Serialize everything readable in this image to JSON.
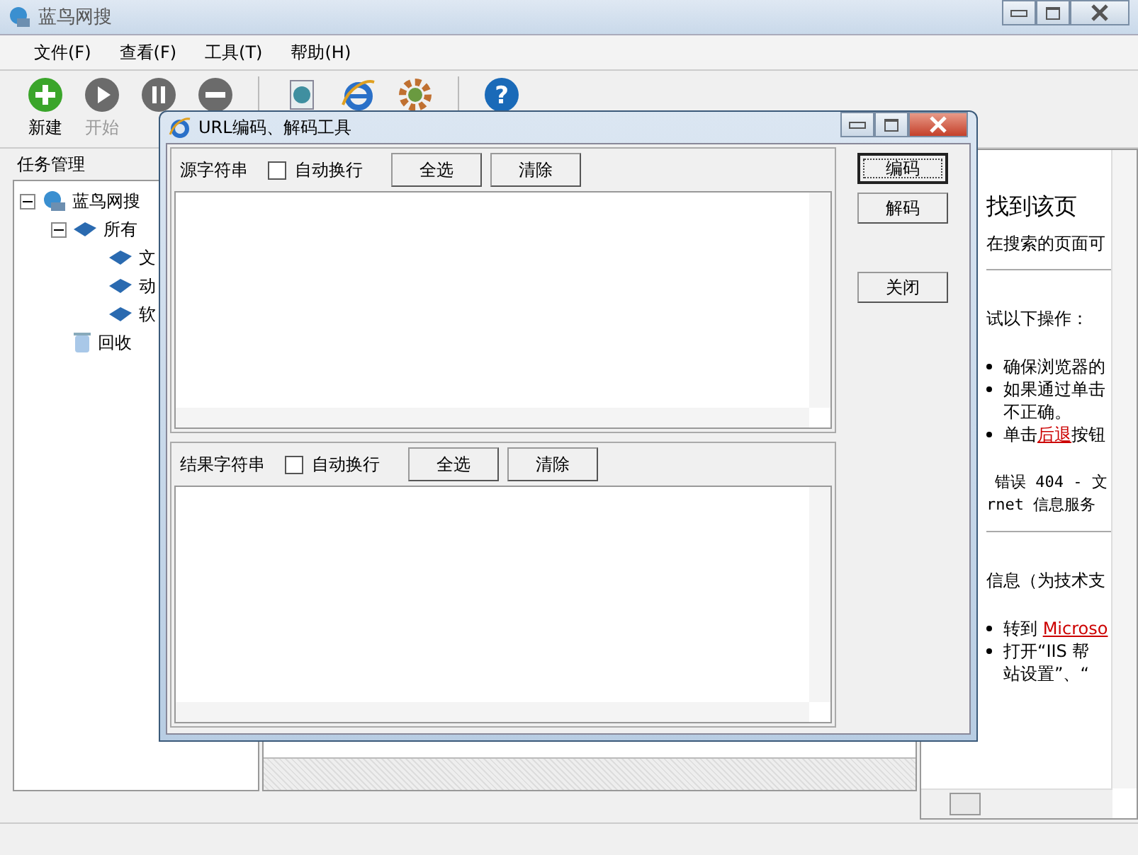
{
  "window": {
    "title": "蓝鸟网搜"
  },
  "menu": [
    "文件(F)",
    "查看(F)",
    "工具(T)",
    "帮助(H)"
  ],
  "toolbar": [
    {
      "kind": "add",
      "label": "新建",
      "disabled": false
    },
    {
      "kind": "play",
      "label": "开始",
      "disabled": true
    },
    {
      "kind": "pause",
      "disabled": true
    },
    {
      "kind": "stop",
      "disabled": true
    },
    {
      "kind": "separator"
    },
    {
      "kind": "globe"
    },
    {
      "kind": "browser"
    },
    {
      "kind": "gear"
    },
    {
      "kind": "separator"
    },
    {
      "kind": "help",
      "glyph": "?"
    }
  ],
  "sidebar": {
    "title": "任务管理",
    "tree": [
      {
        "label": "蓝鸟网搜",
        "kind": "site",
        "expanded": true,
        "children": [
          {
            "label": "所有",
            "kind": "folder",
            "expanded": true,
            "children": [
              {
                "label": "文",
                "kind": "folder"
              },
              {
                "label": "动",
                "kind": "folder"
              },
              {
                "label": "软",
                "kind": "folder"
              }
            ]
          },
          {
            "label": "回收",
            "kind": "trash"
          }
        ]
      }
    ]
  },
  "web_page": {
    "heading": "找到该页",
    "lines": [
      {
        "kind": "text",
        "text": "在搜索的页面可"
      },
      {
        "kind": "rule"
      },
      {
        "kind": "text",
        "text": "试以下操作："
      },
      {
        "kind": "bullet",
        "text": "确保浏览器的"
      },
      {
        "kind": "bullet",
        "text": "如果通过单击"
      },
      {
        "kind": "cont",
        "text": "不正确。"
      },
      {
        "kind": "bullet",
        "text": "单击**后退**按钮"
      },
      {
        "kind": "mono",
        "text": "错误 404 - 文"
      },
      {
        "kind": "mono2",
        "text": "rnet 信息服务"
      },
      {
        "kind": "rule"
      },
      {
        "kind": "text",
        "text": "信息（为技术支"
      },
      {
        "kind": "bullet",
        "text": "转到 **Microso**"
      },
      {
        "kind": "bullet",
        "text": "打开“IIS 帮"
      },
      {
        "kind": "cont",
        "text": "站设置”、“"
      }
    ]
  },
  "dialog": {
    "title": "URL编码、解码工具",
    "sections": [
      {
        "label": "源字符串",
        "wrap_label": "自动换行",
        "wrap_checked": false,
        "buttons": [
          "全选",
          "清除"
        ]
      },
      {
        "label": "结果字符串",
        "wrap_label": "自动换行",
        "wrap_checked": false,
        "buttons": [
          "全选",
          "清除"
        ]
      }
    ],
    "actions": [
      {
        "label": "编码",
        "focused": true
      },
      {
        "label": "解码",
        "focused": false
      },
      {
        "label": "关闭",
        "focused": false
      }
    ]
  }
}
